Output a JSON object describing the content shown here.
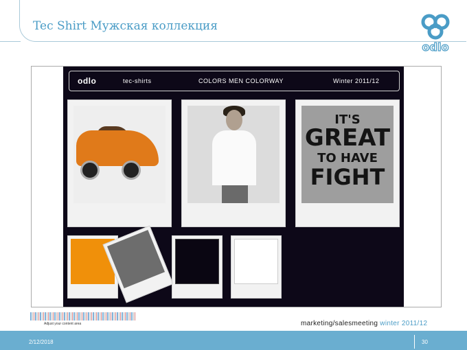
{
  "slide": {
    "title": "Tec Shirt Мужская коллекция",
    "date": "2/12/2018",
    "page_number": "30"
  },
  "logo": {
    "text": "odlo",
    "icon": "odlo-logo-icon"
  },
  "board": {
    "header_logo": "odlo",
    "header_sub": "tec-shirts",
    "header_center": "COLORS MEN COLORWAY",
    "header_right": "Winter 2011/12",
    "sign_text": [
      "IT'S",
      "GREAT",
      "TO HAVE",
      "FIGHT"
    ]
  },
  "strip": {
    "caption": "Adjust your content area",
    "footer_caption_main": "marketing/salesmeeting ",
    "footer_caption_accent": "winter 2011/12"
  },
  "colors": {
    "accent": "#4a9cc6",
    "footer_bg": "#6aaed0",
    "board_bg": "#0d0818",
    "swatch_orange": "#f0900a",
    "swatch_grey": "#6d6d6d",
    "swatch_black": "#0a0612",
    "swatch_white": "#ffffff"
  }
}
